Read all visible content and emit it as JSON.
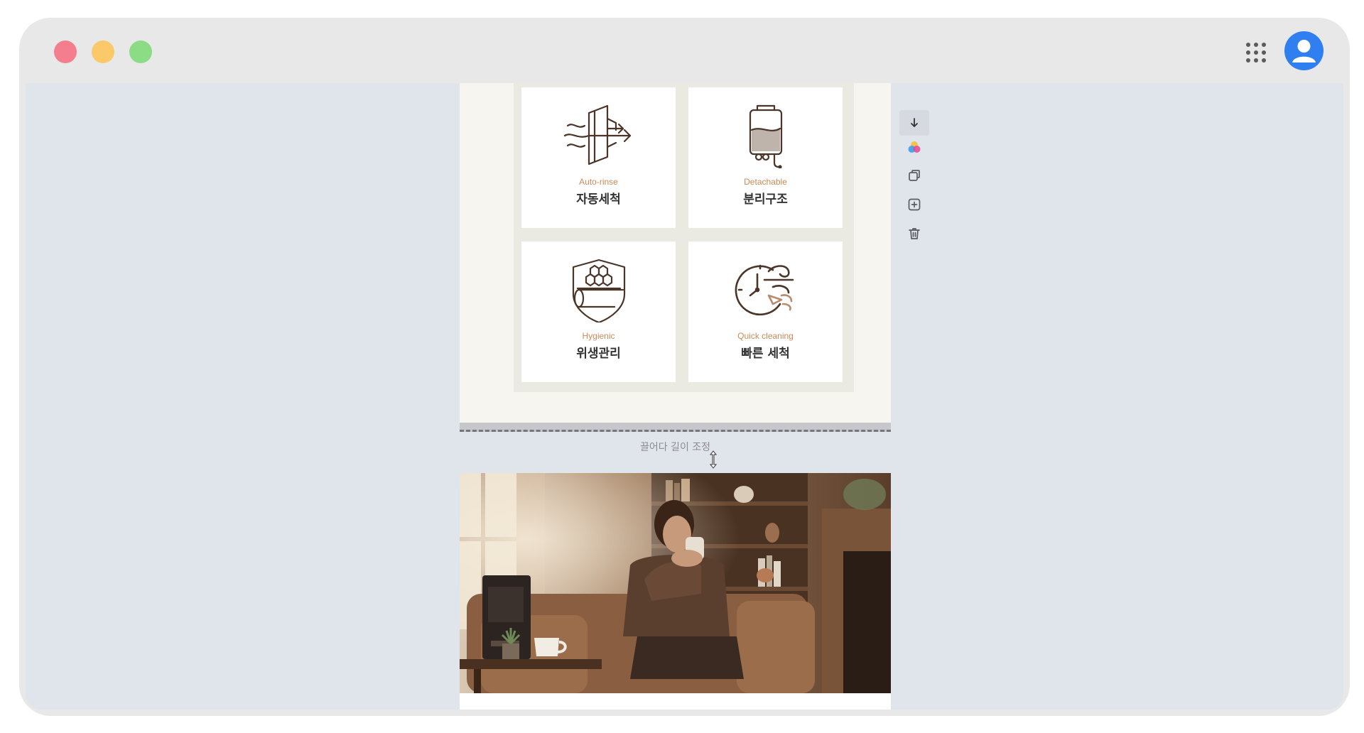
{
  "window": {
    "controls": [
      "close",
      "minimize",
      "maximize"
    ],
    "apps_icon": "grid-icon",
    "avatar_icon": "user-icon",
    "accent_color": "#2f7ff0"
  },
  "features": [
    {
      "en": "Auto-rinse",
      "ko": "자동세척",
      "icon": "water-flow-icon"
    },
    {
      "en": "Detachable",
      "ko": "분리구조",
      "icon": "water-tank-icon"
    },
    {
      "en": "Hygienic",
      "ko": "위생관리",
      "icon": "hygiene-shield-icon"
    },
    {
      "en": "Quick cleaning",
      "ko": "빠른 세척",
      "icon": "clock-wind-icon"
    }
  ],
  "editor": {
    "resize_hint": "끌어다 길이 조정",
    "photo": "woman-drinking-coffee-photo"
  },
  "toolbar": {
    "items": [
      "arrow-down-icon",
      "palette-icon",
      "duplicate-icon",
      "add-block-icon",
      "trash-icon"
    ]
  },
  "colors": {
    "feature_en": "#c98a57",
    "icon_stroke": "#4a3528",
    "canvas_bg": "#e0e4eb"
  }
}
